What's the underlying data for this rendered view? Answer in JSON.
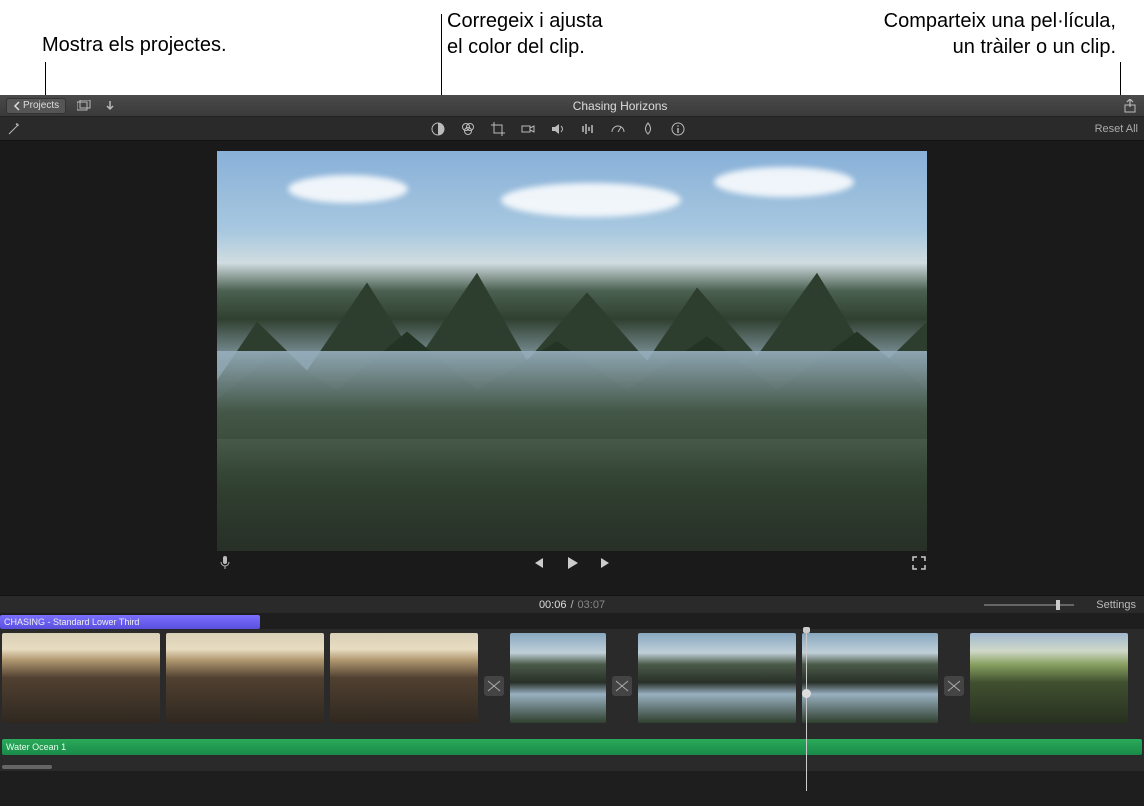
{
  "callouts": {
    "projects": "Mostra els projectes.",
    "color": "Corregeix i ajusta\nel color del clip.",
    "share": "Comparteix una pel·lícula,\nun tràiler o un clip."
  },
  "toolbar": {
    "projects_label": "Projects",
    "title": "Chasing Horizons"
  },
  "icons": {
    "back": "chevron-left",
    "media": "media-library",
    "import": "import-arrow",
    "share": "share",
    "wand": "magic-wand",
    "color_balance": "color-balance",
    "color_correct": "color-palette",
    "crop": "crop",
    "stabilize": "camera",
    "volume": "volume",
    "noise": "equalizer",
    "speed": "speedometer",
    "filter": "filter-drop",
    "info": "info",
    "mic": "microphone",
    "prev": "previous",
    "play": "play",
    "next": "next",
    "fullscreen": "fullscreen",
    "transition": "transition"
  },
  "adjust": {
    "reset": "Reset All"
  },
  "time": {
    "current": "00:06",
    "total": "03:07",
    "settings": "Settings"
  },
  "timeline": {
    "title_overlay": "CHASING - Standard Lower Third",
    "audio_track": "Water Ocean 1"
  }
}
